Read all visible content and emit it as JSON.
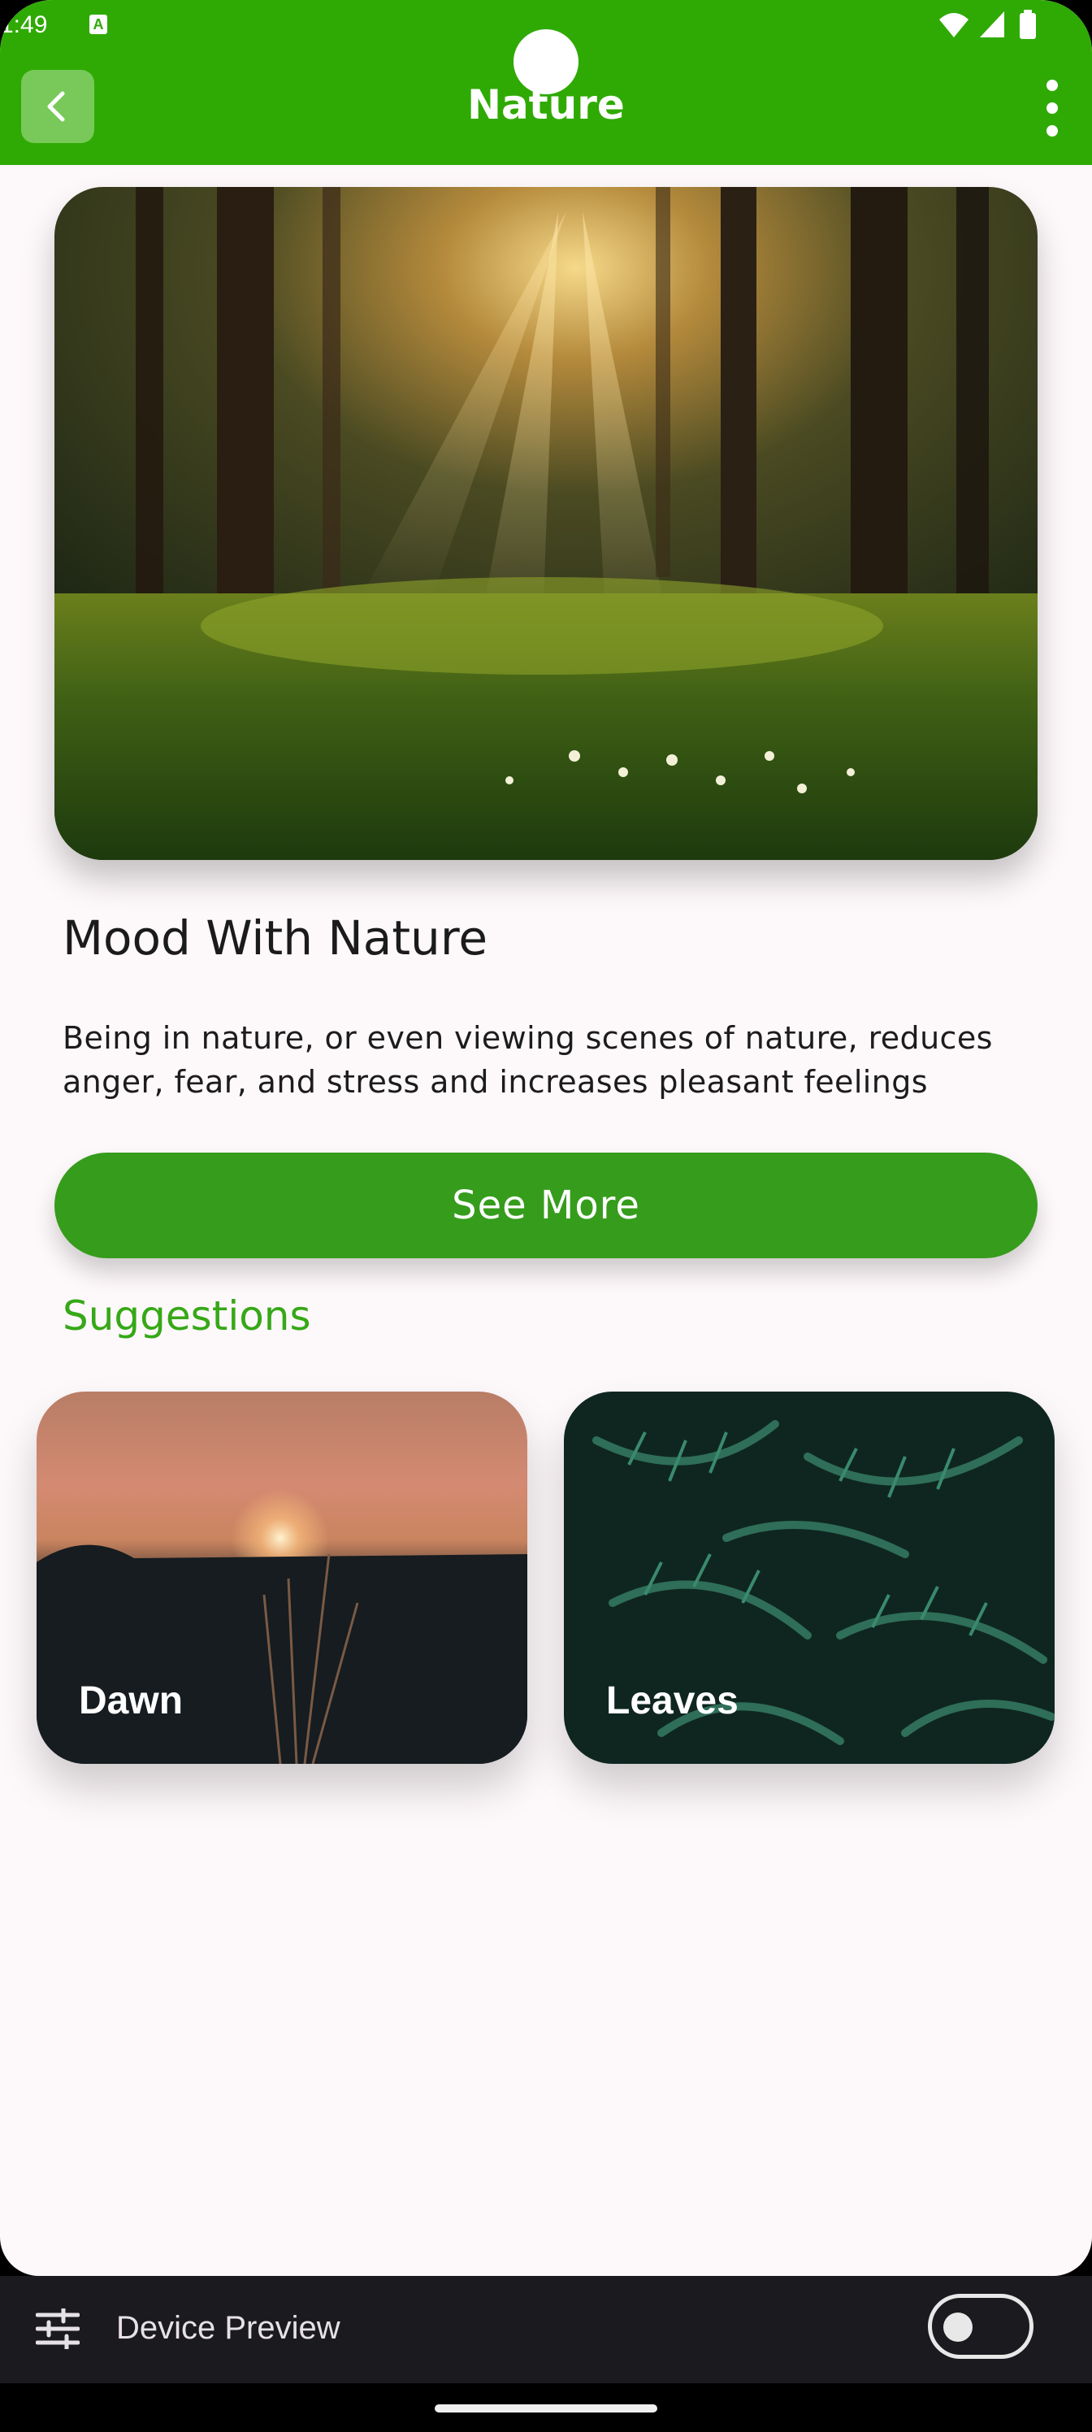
{
  "status_bar": {
    "time": "1:49",
    "indicator": "A"
  },
  "app_bar": {
    "title": "Nature",
    "back_icon": "chevron-left-icon",
    "menu_icon": "more-vert-icon",
    "color": "#2faa04"
  },
  "hero": {
    "image": "forest-sunbeams-image"
  },
  "article": {
    "headline": "Mood With Nature",
    "description": "Being in nature, or even viewing scenes of nature, reduces anger, fear, and stress and increases pleasant feelings",
    "button_label": "See More"
  },
  "suggestions": {
    "title": "Suggestions",
    "items": [
      {
        "label": "Dawn",
        "image": "sunset-grass-image"
      },
      {
        "label": "Leaves",
        "image": "fern-leaves-image"
      }
    ]
  },
  "device_preview": {
    "label": "Device Preview",
    "toggle_on": false
  },
  "colors": {
    "accent": "#2faa04",
    "button": "#369c1c",
    "section_title": "#36a817",
    "background": "#fdf8fa"
  }
}
